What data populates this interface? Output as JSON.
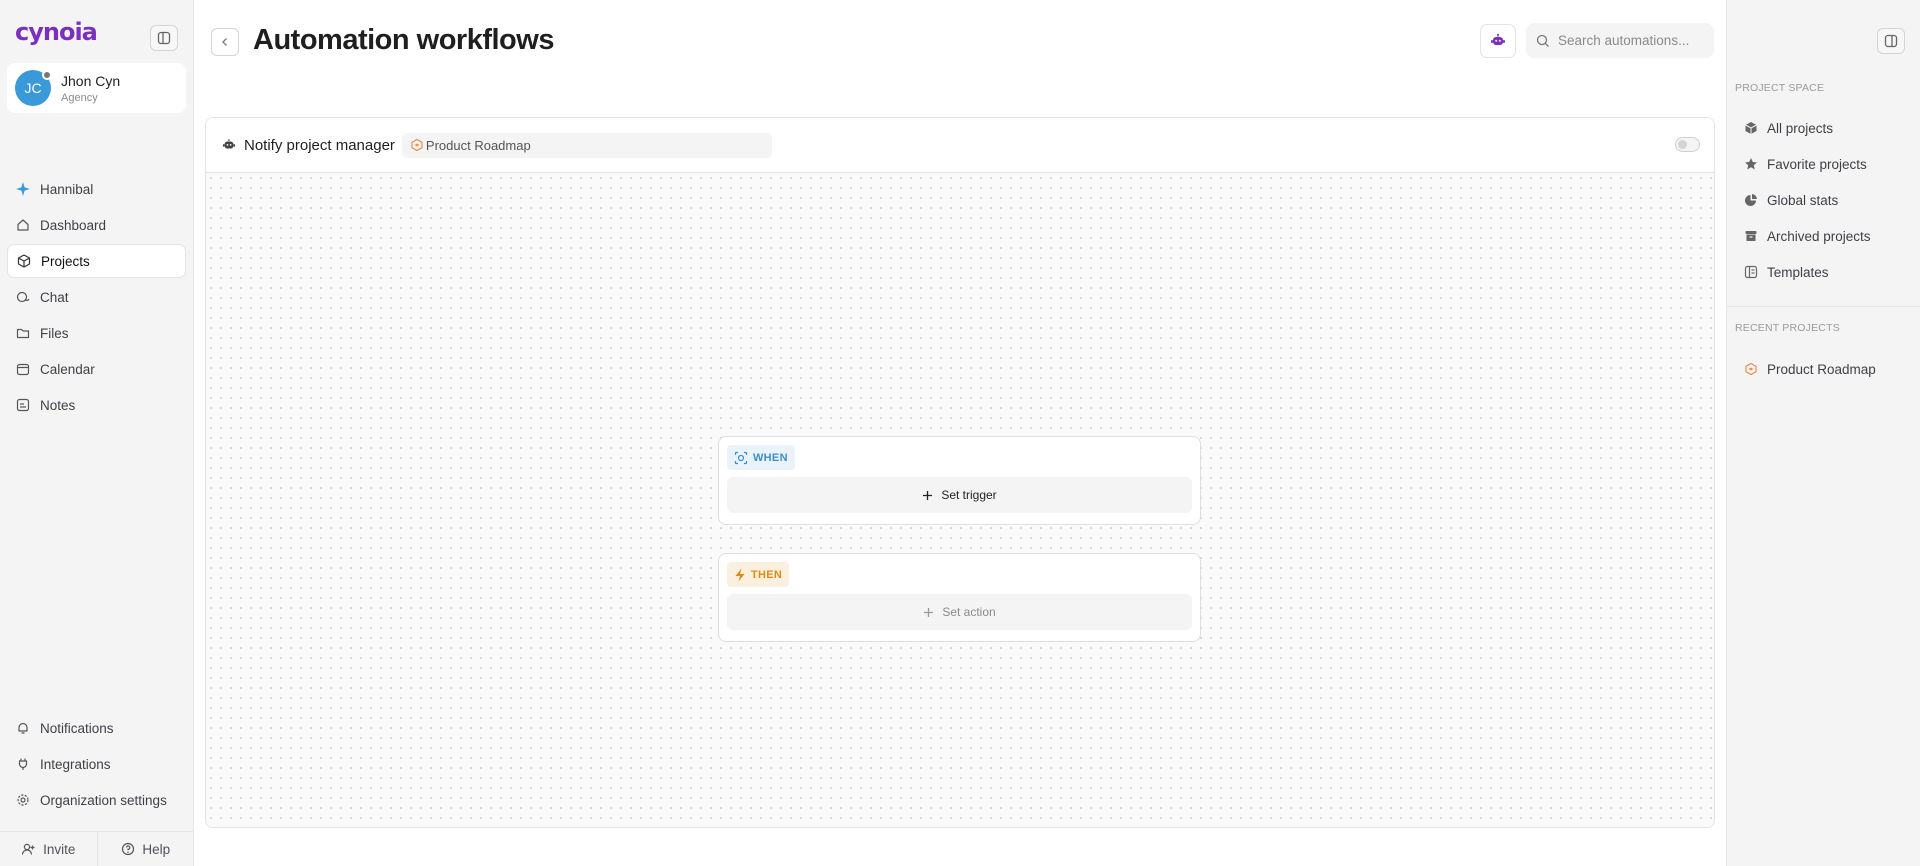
{
  "app": {
    "logo_text": "cynoia",
    "brand_color": "#7b2fbe"
  },
  "user": {
    "initials": "JC",
    "name": "Jhon Cyn",
    "role": "Agency"
  },
  "nav": {
    "items": [
      {
        "label": "Hannibal",
        "icon": "sparkle-icon"
      },
      {
        "label": "Dashboard",
        "icon": "home-icon"
      },
      {
        "label": "Projects",
        "icon": "cube-icon",
        "active": true
      },
      {
        "label": "Chat",
        "icon": "chat-icon"
      },
      {
        "label": "Files",
        "icon": "folder-icon"
      },
      {
        "label": "Calendar",
        "icon": "calendar-icon"
      },
      {
        "label": "Notes",
        "icon": "notes-icon"
      }
    ],
    "bottom": [
      {
        "label": "Notifications",
        "icon": "bell-icon"
      },
      {
        "label": "Integrations",
        "icon": "plug-icon"
      },
      {
        "label": "Organization settings",
        "icon": "gear-icon"
      }
    ],
    "footer": {
      "invite": "Invite",
      "help": "Help"
    }
  },
  "main": {
    "title": "Automation workflows",
    "search": {
      "placeholder": "Search automations..."
    },
    "workflow": {
      "title": "Notify project manager",
      "project": "Product Roadmap",
      "enabled": false,
      "when_label": "WHEN",
      "set_trigger": "Set trigger",
      "then_label": "THEN",
      "set_action": "Set action"
    }
  },
  "right_sidebar": {
    "project_space_title": "PROJECT SPACE",
    "items": [
      {
        "label": "All projects",
        "icon": "cube-icon"
      },
      {
        "label": "Favorite projects",
        "icon": "star-icon"
      },
      {
        "label": "Global stats",
        "icon": "pie-chart-icon"
      },
      {
        "label": "Archived projects",
        "icon": "archive-icon"
      },
      {
        "label": "Templates",
        "icon": "template-icon"
      }
    ],
    "recent_title": "RECENT PROJECTS",
    "recent": [
      {
        "label": "Product Roadmap",
        "icon": "project-icon",
        "color": "#f08c4f"
      }
    ]
  }
}
